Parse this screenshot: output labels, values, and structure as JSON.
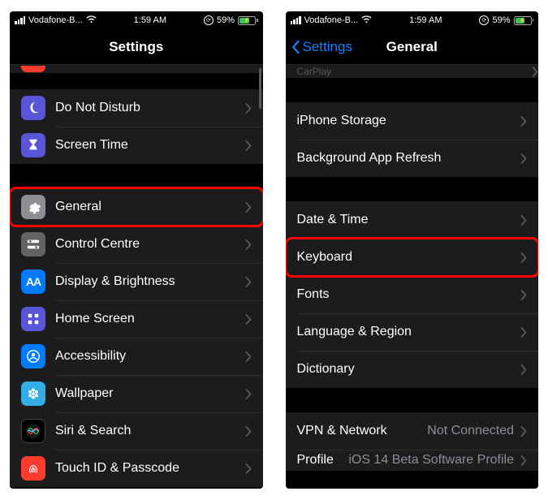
{
  "status": {
    "carrier": "Vodafone-B...",
    "time": "1:59 AM",
    "battery_pct": "59%"
  },
  "left": {
    "title": "Settings",
    "groups": [
      {
        "rows": [
          {
            "icon": "moon",
            "icon_bg": "ic-purple",
            "label": "Do Not Disturb"
          },
          {
            "icon": "hourglass",
            "icon_bg": "ic-purple",
            "label": "Screen Time"
          }
        ]
      },
      {
        "rows": [
          {
            "icon": "gear",
            "icon_bg": "ic-gray",
            "label": "General",
            "highlighted": true
          },
          {
            "icon": "switches",
            "icon_bg": "ic-darkgray",
            "label": "Control Centre"
          },
          {
            "icon": "AA",
            "icon_bg": "ic-blue",
            "label": "Display & Brightness"
          },
          {
            "icon": "grid",
            "icon_bg": "ic-purple",
            "label": "Home Screen"
          },
          {
            "icon": "person",
            "icon_bg": "ic-blue",
            "label": "Accessibility"
          },
          {
            "icon": "flower",
            "icon_bg": "ic-cyan",
            "label": "Wallpaper"
          },
          {
            "icon": "siri",
            "icon_bg": "ic-black",
            "label": "Siri & Search"
          },
          {
            "icon": "fingerprint",
            "icon_bg": "ic-red",
            "label": "Touch ID & Passcode"
          }
        ]
      }
    ]
  },
  "right": {
    "back": "Settings",
    "title": "General",
    "groups": [
      {
        "partial_top": true,
        "rows": [
          {
            "label": "CarPlay"
          }
        ]
      },
      {
        "rows": [
          {
            "label": "iPhone Storage"
          },
          {
            "label": "Background App Refresh"
          }
        ]
      },
      {
        "rows": [
          {
            "label": "Date & Time"
          },
          {
            "label": "Keyboard",
            "highlighted": true
          },
          {
            "label": "Fonts"
          },
          {
            "label": "Language & Region"
          },
          {
            "label": "Dictionary"
          }
        ]
      },
      {
        "rows": [
          {
            "label": "VPN & Network",
            "detail": "Not Connected"
          },
          {
            "label": "Profile",
            "detail": "iOS 14 Beta Software Profile",
            "partial_bottom": true
          }
        ]
      }
    ]
  }
}
